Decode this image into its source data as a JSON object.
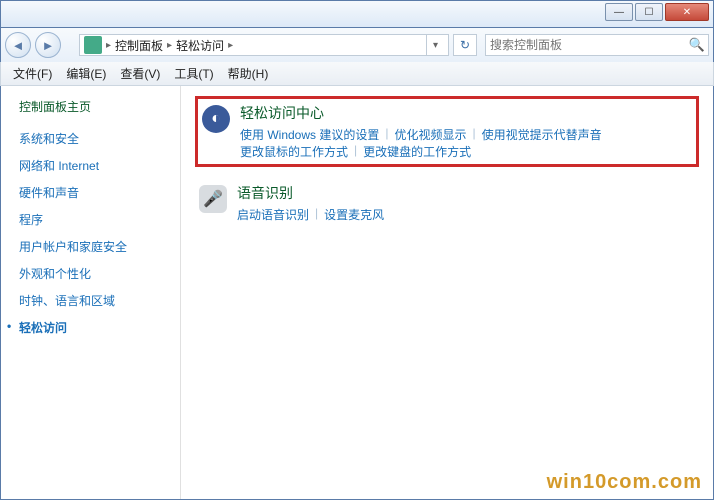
{
  "breadcrumb": {
    "seg1": "控制面板",
    "seg2": "轻松访问"
  },
  "search": {
    "placeholder": "搜索控制面板"
  },
  "menu": {
    "file": "文件(F)",
    "edit": "编辑(E)",
    "view": "查看(V)",
    "tools": "工具(T)",
    "help": "帮助(H)"
  },
  "sidebar": {
    "title": "控制面板主页",
    "links": [
      "系统和安全",
      "网络和 Internet",
      "硬件和声音",
      "程序",
      "用户帐户和家庭安全",
      "外观和个性化",
      "时钟、语言和区域",
      "轻松访问"
    ]
  },
  "ease": {
    "title": "轻松访问中心",
    "l1": "使用 Windows 建议的设置",
    "l2": "优化视频显示",
    "l3": "使用视觉提示代替声音",
    "l4": "更改鼠标的工作方式",
    "l5": "更改键盘的工作方式"
  },
  "speech": {
    "title": "语音识别",
    "l1": "启动语音识别",
    "l2": "设置麦克风"
  },
  "watermark": "win10com.com"
}
